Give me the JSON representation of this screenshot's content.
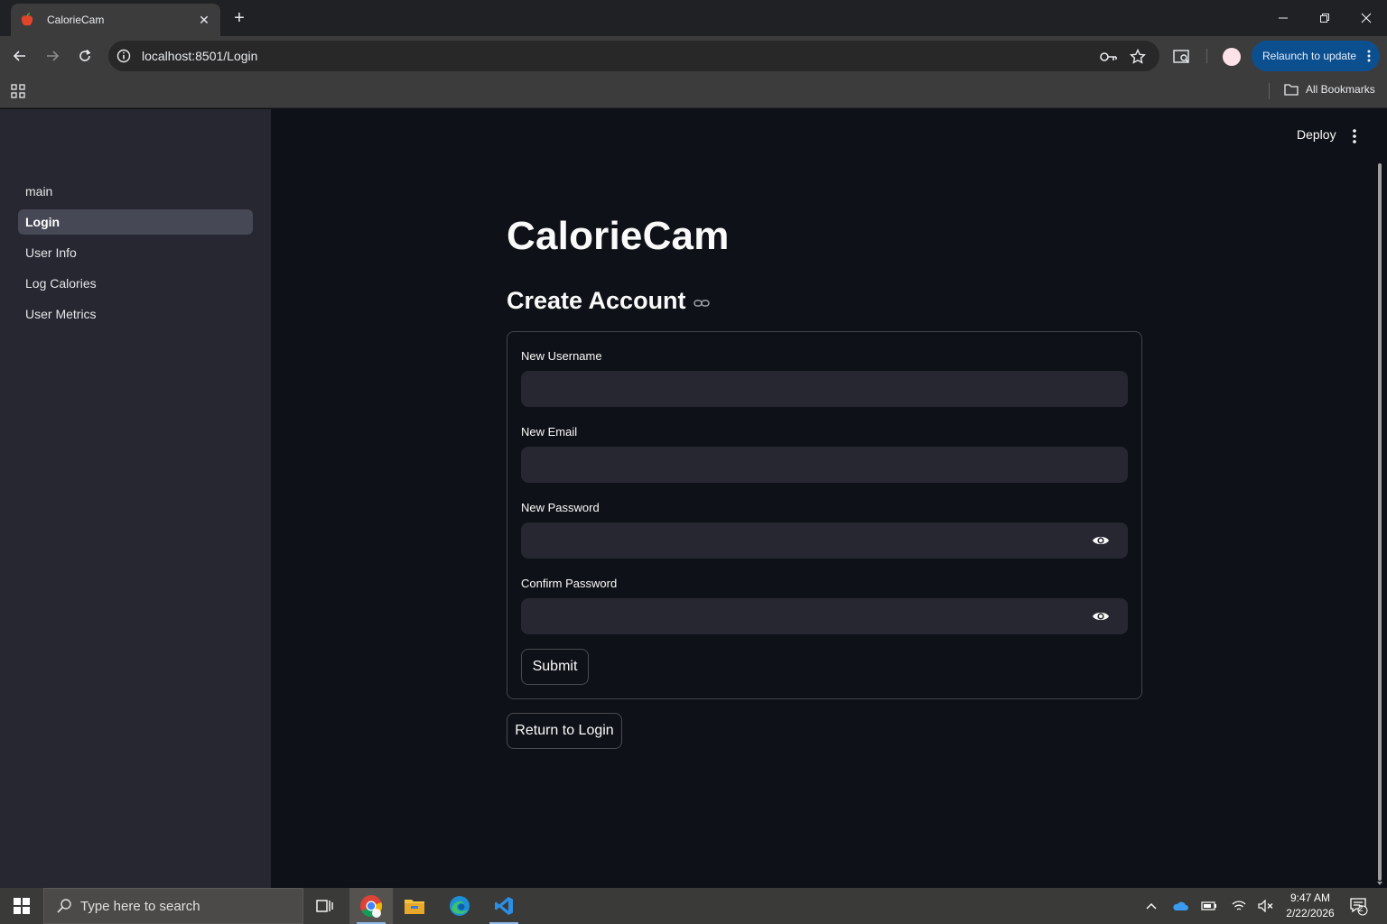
{
  "browser": {
    "tab_title": "CalorieCam",
    "url": "localhost:8501/Login",
    "relaunch_label": "Relaunch to update",
    "all_bookmarks_label": "All Bookmarks"
  },
  "sidebar": {
    "items": [
      {
        "label": "main",
        "active": false
      },
      {
        "label": "Login",
        "active": true
      },
      {
        "label": "User Info",
        "active": false
      },
      {
        "label": "Log Calories",
        "active": false
      },
      {
        "label": "User Metrics",
        "active": false
      }
    ]
  },
  "header": {
    "deploy_label": "Deploy"
  },
  "main": {
    "title": "CalorieCam",
    "section_title": "Create Account",
    "form": {
      "username_label": "New Username",
      "email_label": "New Email",
      "password_label": "New Password",
      "confirm_label": "Confirm Password",
      "username_value": "",
      "email_value": "",
      "password_value": "",
      "confirm_value": "",
      "submit_label": "Submit"
    },
    "return_label": "Return to Login"
  },
  "taskbar": {
    "search_placeholder": "Type here to search",
    "time": "9:47 AM",
    "date": "2/22/2026",
    "notification_count": "2"
  },
  "colors": {
    "app_bg": "#0e1117",
    "sidebar_bg": "#262730",
    "input_bg": "#262730",
    "active_nav": "#464855",
    "relaunch": "#0b4f8f"
  }
}
